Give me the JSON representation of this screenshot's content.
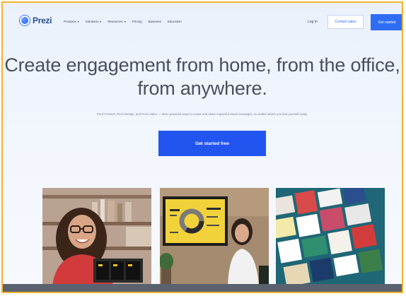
{
  "header": {
    "logo_text": "Prezi",
    "nav": [
      {
        "label": "Products",
        "caret": "▾"
      },
      {
        "label": "Solutions",
        "caret": "▾"
      },
      {
        "label": "Resources",
        "caret": "▾"
      },
      {
        "label": "Pricing",
        "caret": ""
      },
      {
        "label": "Business",
        "caret": ""
      },
      {
        "label": "Education",
        "caret": ""
      }
    ],
    "login_label": "Log in",
    "contact_label": "Contact sales",
    "get_started_label": "Get started"
  },
  "hero": {
    "title_line1": "Create engagement from home, from the office,",
    "title_line2": "from anywhere.",
    "subtitle": "Prezi Present, Prezi Design, and Prezi Video — three powerful ways to create and share impactful visual messages, no matter where you find yourself today.",
    "cta_label": "Get started free"
  },
  "colors": {
    "accent": "#2255f0",
    "frame_border": "#f3b32a",
    "title_text": "#4a4f5c"
  }
}
